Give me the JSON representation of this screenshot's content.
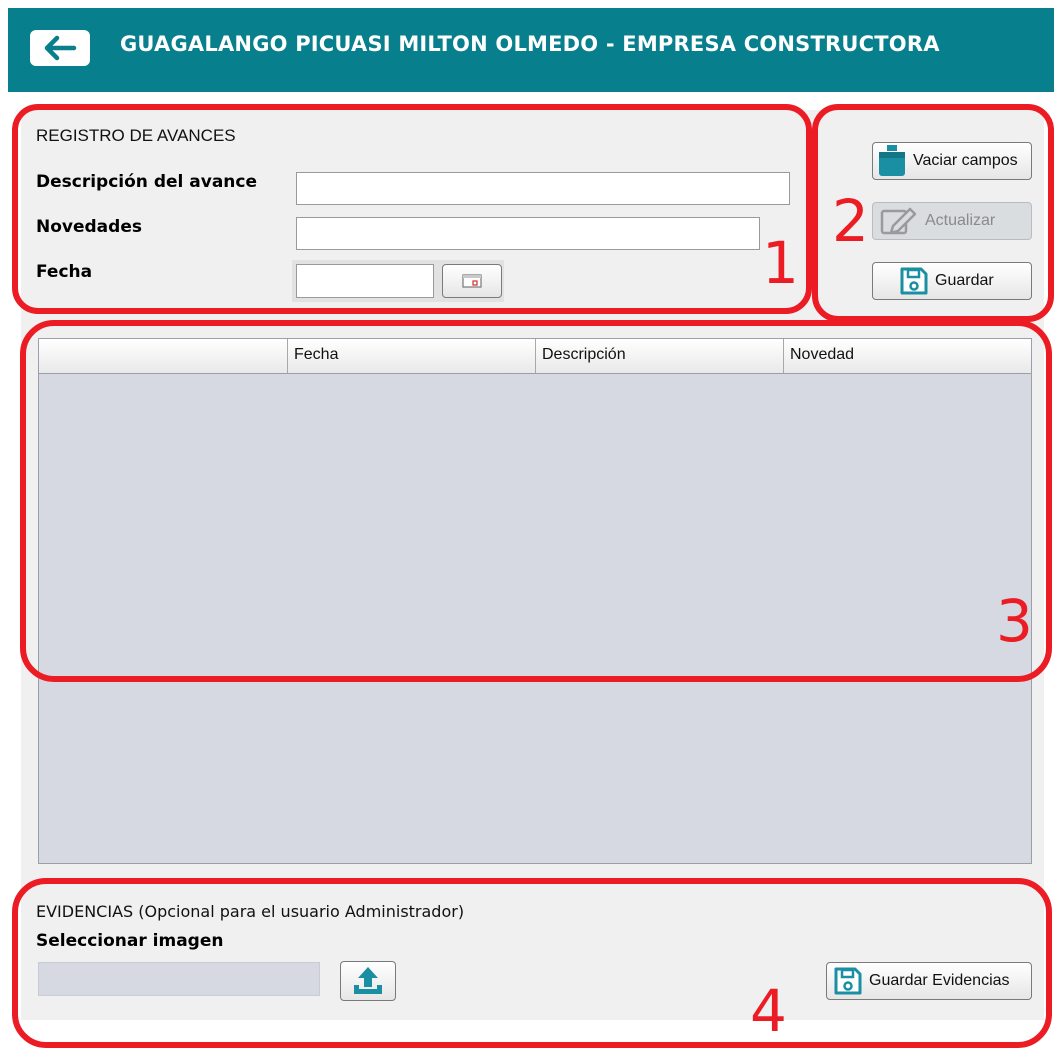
{
  "header": {
    "title": "GUAGALANGO PICUASI MILTON OLMEDO - EMPRESA CONSTRUCTORA"
  },
  "form": {
    "section_title": "REGISTRO DE AVANCES",
    "description_label": "Descripción del avance",
    "description_value": "",
    "news_label": "Novedades",
    "news_value": "",
    "date_label": "Fecha",
    "date_value": ""
  },
  "actions": {
    "clear_label": "Vaciar campos",
    "update_label": "Actualizar",
    "save_label": "Guardar"
  },
  "table": {
    "columns": [
      "",
      "Fecha",
      "Descripción",
      "Novedad"
    ],
    "rows": []
  },
  "evidence": {
    "section_title": "EVIDENCIAS (Opcional para el usuario Administrador)",
    "select_label": "Seleccionar imagen",
    "file_value": "",
    "save_label": "Guardar Evidencias"
  },
  "annotations": [
    "1",
    "2",
    "3",
    "4"
  ],
  "colors": {
    "header_bg": "#087f8c",
    "annotation": "#ec1c24",
    "table_bg": "#d6d9e1",
    "icon_teal": "#1a8fa3"
  }
}
